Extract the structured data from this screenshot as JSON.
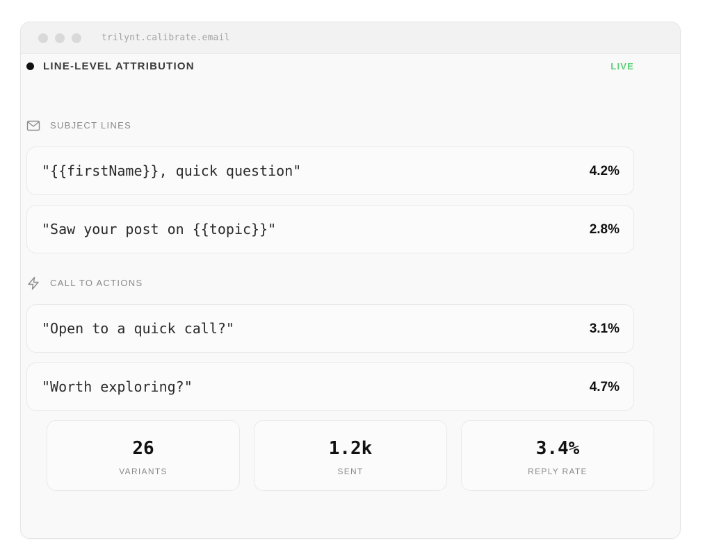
{
  "window": {
    "url": "trilynt.calibrate.email"
  },
  "panel": {
    "title": "LINE-LEVEL ATTRIBUTION",
    "status": "LIVE",
    "status_color": "#5fcf7a"
  },
  "subject_lines": {
    "label": "SUBJECT LINES",
    "icon": "mail-icon",
    "items": [
      {
        "text": "\"{{firstName}}, quick question\"",
        "rate": "4.2%"
      },
      {
        "text": "\"Saw your post on {{topic}}\"",
        "rate": "2.8%"
      }
    ]
  },
  "call_to_actions": {
    "label": "CALL TO ACTIONS",
    "icon": "lightning-icon",
    "items": [
      {
        "text": "\"Open to a quick call?\"",
        "rate": "3.1%"
      },
      {
        "text": "\"Worth exploring?\"",
        "rate": "4.7%"
      }
    ]
  },
  "stats": [
    {
      "value": "26",
      "label": "VARIANTS"
    },
    {
      "value": "1.2k",
      "label": "SENT"
    },
    {
      "value": "3.4%",
      "label": "REPLY RATE"
    }
  ]
}
